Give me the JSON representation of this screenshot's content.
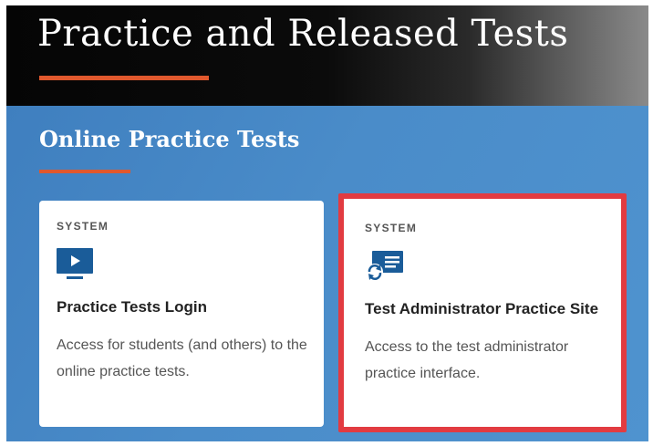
{
  "header": {
    "title": "Practice and Released Tests"
  },
  "section": {
    "title": "Online Practice Tests"
  },
  "cards": [
    {
      "eyebrow": "SYSTEM",
      "icon": "monitor-play-icon",
      "title": "Practice Tests Login",
      "description": "Access for students (and others) to the online practice tests."
    },
    {
      "eyebrow": "SYSTEM",
      "icon": "admin-refresh-icon",
      "title": "Test Administrator Practice Site",
      "description": "Access to the test administrator practice interface."
    }
  ],
  "colors": {
    "accent": "#e0582d",
    "section_blue": "#4a8cc9",
    "icon_blue": "#1a5c99",
    "highlight": "#e23b41"
  }
}
